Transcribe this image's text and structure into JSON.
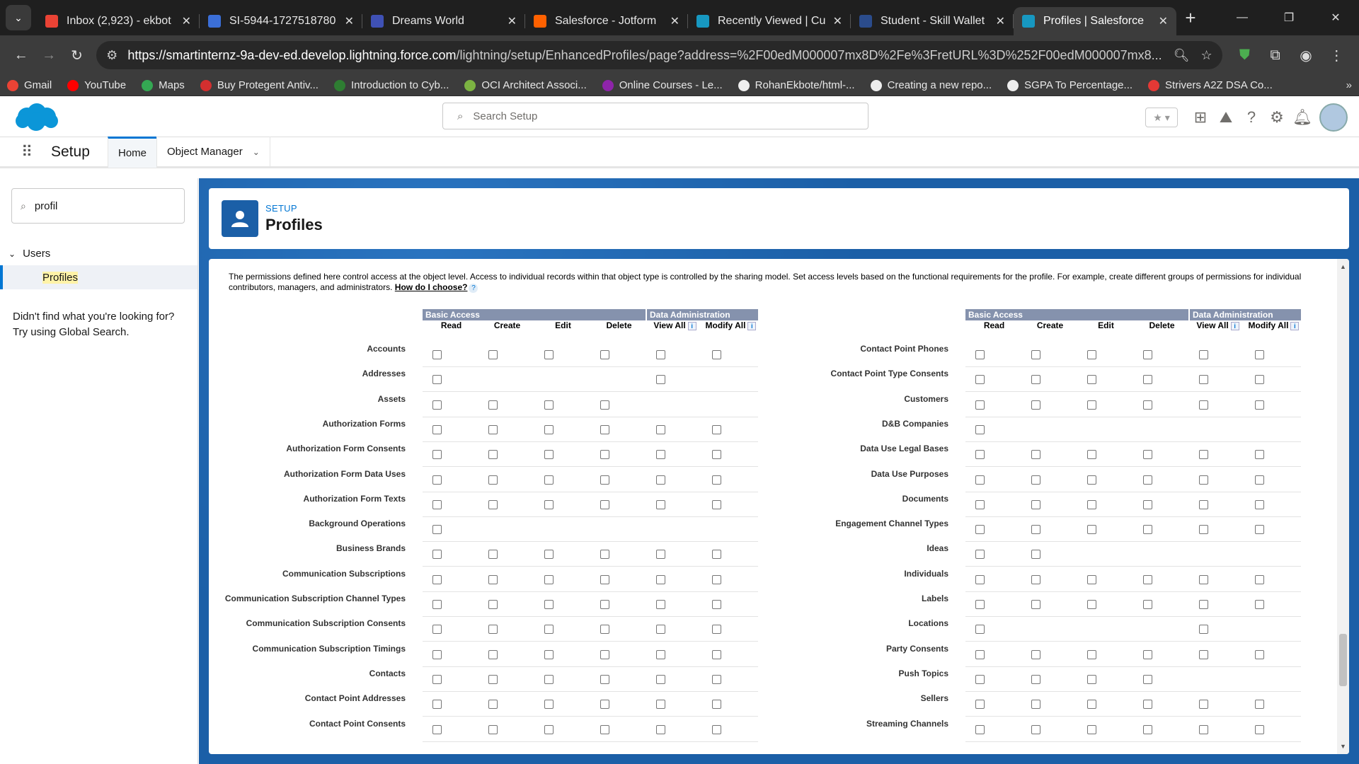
{
  "browser": {
    "tabs": [
      {
        "title": "Inbox (2,923) - ekbot",
        "color": "#ea4335",
        "active": false
      },
      {
        "title": "SI-5944-1727518780",
        "color": "#3b6fd8",
        "active": false
      },
      {
        "title": "Dreams World",
        "color": "#3f51b5",
        "active": false
      },
      {
        "title": "Salesforce - Jotform",
        "color": "#ff6100",
        "active": false
      },
      {
        "title": "Recently Viewed | Cu",
        "color": "#1798c1",
        "active": false
      },
      {
        "title": "Student - Skill Wallet",
        "color": "#2b4c8c",
        "active": false
      },
      {
        "title": "Profiles | Salesforce",
        "color": "#1798c1",
        "active": true
      }
    ],
    "url_host": "https://smartinternz-9a-dev-ed.develop.lightning.force.com",
    "url_path": "/lightning/setup/EnhancedProfiles/page?address=%2F00edM000007mx8D%2Fe%3FretURL%3D%252F00edM000007mx8...",
    "bookmarks": [
      {
        "label": "Gmail",
        "color": "#ea4335"
      },
      {
        "label": "YouTube",
        "color": "#ff0000"
      },
      {
        "label": "Maps",
        "color": "#34a853"
      },
      {
        "label": "Buy Protegent Antiv...",
        "color": "#d32f2f"
      },
      {
        "label": "Introduction to Cyb...",
        "color": "#2e7d32"
      },
      {
        "label": "OCI Architect Associ...",
        "color": "#7cb342"
      },
      {
        "label": "Online Courses - Le...",
        "color": "#8e24aa"
      },
      {
        "label": "RohanEkbote/html-...",
        "color": "#eeeeee"
      },
      {
        "label": "Creating a new repo...",
        "color": "#eeeeee"
      },
      {
        "label": "SGPA To Percentage...",
        "color": "#eeeeee"
      },
      {
        "label": "Strivers A2Z DSA Co...",
        "color": "#e53935"
      }
    ]
  },
  "sf": {
    "search_placeholder": "Search Setup",
    "app_name": "Setup",
    "nav_home": "Home",
    "nav_object_manager": "Object Manager",
    "quickfind_value": "profil",
    "tree_users": "Users",
    "tree_profiles": "Profiles",
    "notfound_line1": "Didn't find what you're looking for?",
    "notfound_line2": "Try using Global Search.",
    "page_eyebrow": "SETUP",
    "page_title": "Profiles",
    "description": "The permissions defined here control access at the object level. Access to individual records within that object type is controlled by the sharing model. Set access levels based on the functional requirements for the profile. For example, create different groups of permissions for individual contributors, managers, and administrators.",
    "how_link": "How do I choose?",
    "group_basic": "Basic Access",
    "group_data": "Data Administration",
    "columns": [
      "Read",
      "Create",
      "Edit",
      "Delete",
      "View All",
      "Modify All"
    ]
  },
  "left_objects": [
    {
      "name": "Accounts",
      "perms": [
        1,
        1,
        1,
        1,
        1,
        1
      ]
    },
    {
      "name": "Addresses",
      "perms": [
        1,
        0,
        0,
        0,
        1,
        0
      ]
    },
    {
      "name": "Assets",
      "perms": [
        1,
        1,
        1,
        1,
        0,
        0
      ]
    },
    {
      "name": "Authorization Forms",
      "perms": [
        1,
        1,
        1,
        1,
        1,
        1
      ]
    },
    {
      "name": "Authorization Form Consents",
      "perms": [
        1,
        1,
        1,
        1,
        1,
        1
      ]
    },
    {
      "name": "Authorization Form Data Uses",
      "perms": [
        1,
        1,
        1,
        1,
        1,
        1
      ]
    },
    {
      "name": "Authorization Form Texts",
      "perms": [
        1,
        1,
        1,
        1,
        1,
        1
      ]
    },
    {
      "name": "Background Operations",
      "perms": [
        1,
        0,
        0,
        0,
        0,
        0
      ]
    },
    {
      "name": "Business Brands",
      "perms": [
        1,
        1,
        1,
        1,
        1,
        1
      ]
    },
    {
      "name": "Communication Subscriptions",
      "perms": [
        1,
        1,
        1,
        1,
        1,
        1
      ]
    },
    {
      "name": "Communication Subscription Channel Types",
      "perms": [
        1,
        1,
        1,
        1,
        1,
        1
      ]
    },
    {
      "name": "Communication Subscription Consents",
      "perms": [
        1,
        1,
        1,
        1,
        1,
        1
      ]
    },
    {
      "name": "Communication Subscription Timings",
      "perms": [
        1,
        1,
        1,
        1,
        1,
        1
      ]
    },
    {
      "name": "Contacts",
      "perms": [
        1,
        1,
        1,
        1,
        1,
        1
      ]
    },
    {
      "name": "Contact Point Addresses",
      "perms": [
        1,
        1,
        1,
        1,
        1,
        1
      ]
    },
    {
      "name": "Contact Point Consents",
      "perms": [
        1,
        1,
        1,
        1,
        1,
        1
      ]
    }
  ],
  "right_objects": [
    {
      "name": "Contact Point Phones",
      "perms": [
        1,
        1,
        1,
        1,
        1,
        1
      ]
    },
    {
      "name": "Contact Point Type Consents",
      "perms": [
        1,
        1,
        1,
        1,
        1,
        1
      ]
    },
    {
      "name": "Customers",
      "perms": [
        1,
        1,
        1,
        1,
        1,
        1
      ]
    },
    {
      "name": "D&B Companies",
      "perms": [
        1,
        0,
        0,
        0,
        0,
        0
      ]
    },
    {
      "name": "Data Use Legal Bases",
      "perms": [
        1,
        1,
        1,
        1,
        1,
        1
      ]
    },
    {
      "name": "Data Use Purposes",
      "perms": [
        1,
        1,
        1,
        1,
        1,
        1
      ]
    },
    {
      "name": "Documents",
      "perms": [
        1,
        1,
        1,
        1,
        1,
        1
      ]
    },
    {
      "name": "Engagement Channel Types",
      "perms": [
        1,
        1,
        1,
        1,
        1,
        1
      ]
    },
    {
      "name": "Ideas",
      "perms": [
        1,
        1,
        0,
        0,
        0,
        0
      ]
    },
    {
      "name": "Individuals",
      "perms": [
        1,
        1,
        1,
        1,
        1,
        1
      ]
    },
    {
      "name": "Labels",
      "perms": [
        1,
        1,
        1,
        1,
        1,
        1
      ]
    },
    {
      "name": "Locations",
      "perms": [
        1,
        0,
        0,
        0,
        1,
        0
      ]
    },
    {
      "name": "Party Consents",
      "perms": [
        1,
        1,
        1,
        1,
        1,
        1
      ]
    },
    {
      "name": "Push Topics",
      "perms": [
        1,
        1,
        1,
        1,
        0,
        0
      ]
    },
    {
      "name": "Sellers",
      "perms": [
        1,
        1,
        1,
        1,
        1,
        1
      ]
    },
    {
      "name": "Streaming Channels",
      "perms": [
        1,
        1,
        1,
        1,
        1,
        1
      ]
    }
  ]
}
